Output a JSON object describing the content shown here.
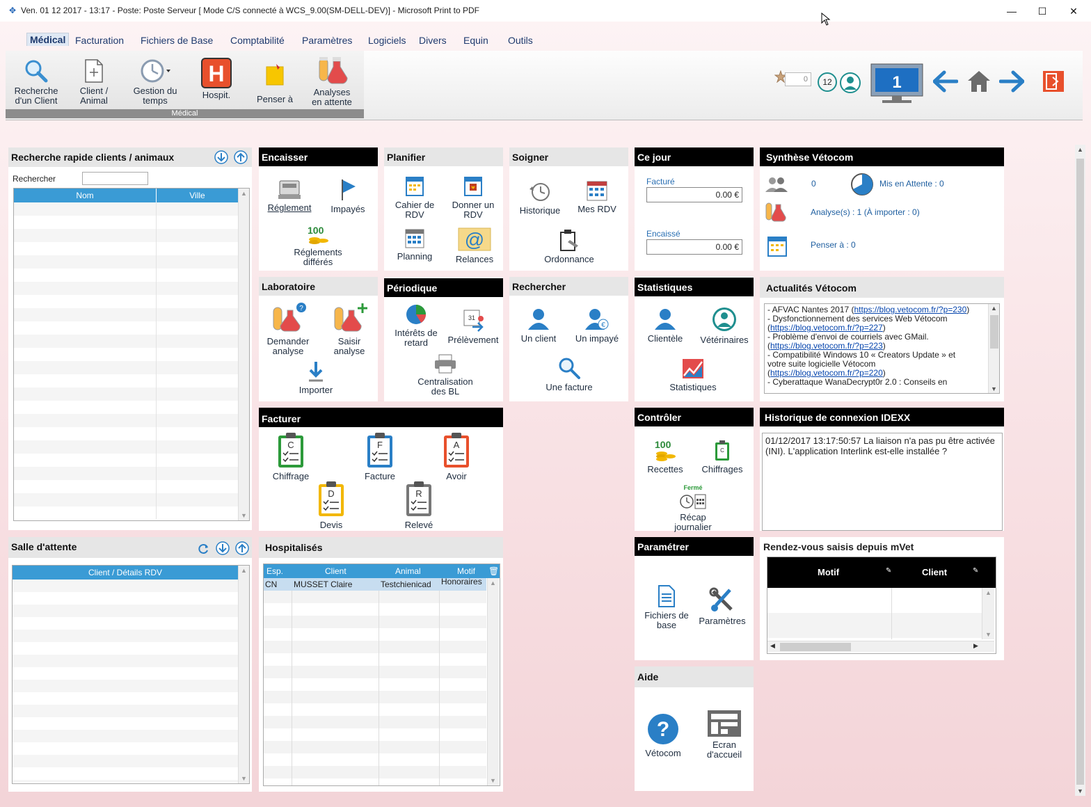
{
  "window": {
    "title": "Ven. 01 12 2017 - 13:17 - Poste: Poste Serveur  [ Mode C/S connecté à WCS_9.00(SM-DELL-DEV)] - Microsoft Print to PDF",
    "minimize": "—",
    "maximize": "☐",
    "close": "✕"
  },
  "menu": [
    "Médical",
    "Facturation",
    "Fichiers de Base",
    "Comptabilité",
    "Paramètres",
    "Logiciels",
    "Divers",
    "Equin",
    "Outils"
  ],
  "ribbon": {
    "group_label": "Médical",
    "buttons": [
      {
        "l1": "Recherche",
        "l2": "d'un Client"
      },
      {
        "l1": "Client /",
        "l2": "Animal"
      },
      {
        "l1": "Gestion du",
        "l2": "temps"
      },
      {
        "l1": "",
        "l2": "Hospit."
      },
      {
        "l1": "",
        "l2": "Penser à"
      },
      {
        "l1": "Analyses",
        "l2": "en attente"
      }
    ],
    "hospit_letter": "H",
    "star_value": "0",
    "badge_count": "12",
    "monitor_number": "1"
  },
  "quick_search": {
    "title": "Recherche rapide clients / animaux",
    "search_label": "Rechercher",
    "search_value": "",
    "col_nom": "Nom",
    "col_ville": "Ville"
  },
  "waiting_room": {
    "title": "Salle d'attente",
    "col": "Client / Détails RDV"
  },
  "encaisser": {
    "title": "Encaisser",
    "reglement": "Réglement",
    "impayes": "Impayés",
    "reglements_differes_1": "Réglements",
    "reglements_differes_2": "différés"
  },
  "planifier": {
    "title": "Planifier",
    "cahier_1": "Cahier de",
    "cahier_2": "RDV",
    "donner_1": "Donner un",
    "donner_2": "RDV",
    "planning": "Planning",
    "relances": "Relances"
  },
  "soigner": {
    "title": "Soigner",
    "historique": "Historique",
    "mes_rdv": "Mes RDV",
    "ordonnance": "Ordonnance"
  },
  "ce_jour": {
    "title": "Ce jour",
    "facture_label": "Facturé",
    "facture_value": "0.00 €",
    "encaisse_label": "Encaissé",
    "encaisse_value": "0.00 €"
  },
  "synthese": {
    "title": "Synthèse Vétocom",
    "clients_count": "0",
    "mis_en_attente": "Mis en Attente : 0",
    "analyses": "Analyse(s) : 1  (À importer : 0)",
    "penser": "Penser à : 0"
  },
  "laboratoire": {
    "title": "Laboratoire",
    "demander_1": "Demander",
    "demander_2": "analyse",
    "saisir_1": "Saisir",
    "saisir_2": "analyse",
    "importer": "Importer"
  },
  "periodique": {
    "title": "Périodique",
    "interets_1": "Intérêts de",
    "interets_2": "retard",
    "prelevement": "Prélèvement",
    "centralisation_1": "Centralisation",
    "centralisation_2": "des BL"
  },
  "rechercher": {
    "title": "Rechercher",
    "un_client": "Un client",
    "un_impaye": "Un impayé",
    "une_facture": "Une facture"
  },
  "statistiques": {
    "title": "Statistiques",
    "clientele": "Clientèle",
    "veterinaires": "Vétérinaires",
    "statistiques": "Statistiques"
  },
  "actualites": {
    "title": "Actualités Vétocom",
    "lines": [
      {
        "text": "- AFVAC Nantes 2017 (",
        "link": "https://blog.vetocom.fr/?p=230",
        "after": ")"
      },
      {
        "text": "- Dysfonctionnement des services Web Vétocom",
        "link": "",
        "after": ""
      },
      {
        "text": "(",
        "link": "https://blog.vetocom.fr/?p=227",
        "after": ")"
      },
      {
        "text": "- Problème d'envoi de courriels avec GMail.",
        "link": "",
        "after": ""
      },
      {
        "text": "(",
        "link": "https://blog.vetocom.fr/?p=223",
        "after": ")"
      },
      {
        "text": "- Compatibilité Windows 10 « Creators Update » et",
        "link": "",
        "after": ""
      },
      {
        "text": "votre suite logicielle Vétocom",
        "link": "",
        "after": ""
      },
      {
        "text": "(",
        "link": "https://blog.vetocom.fr/?p=220",
        "after": ")"
      },
      {
        "text": "- Cyberattaque WanaDecrypt0r 2.0 : Conseils en",
        "link": "",
        "after": ""
      }
    ]
  },
  "facturer": {
    "title": "Facturer",
    "chiffrage": "Chiffrage",
    "chiffrage_letter": "C",
    "facture": "Facture",
    "facture_letter": "F",
    "avoir": "Avoir",
    "avoir_letter": "A",
    "devis": "Devis",
    "devis_letter": "D",
    "releve": "Relevé",
    "releve_letter": "R"
  },
  "controler": {
    "title": "Contrôler",
    "recettes": "Recettes",
    "chiffrages": "Chiffrages",
    "ferme": "Fermé",
    "recap_1": "Récap",
    "recap_2": "journalier"
  },
  "idexx": {
    "title": "Historique de connexion IDEXX",
    "message": "01/12/2017 13:17:50:57 La liaison n'a pas pu être activée (INI). L'application Interlink est-elle installée ?"
  },
  "hospitalises": {
    "title": "Hospitalisés",
    "cols": [
      "Esp.",
      "Client",
      "Animal",
      "Motif"
    ],
    "rows": [
      {
        "esp": "CN",
        "client": "MUSSET Claire",
        "animal": "Testchienicad",
        "motif": "Honoraires"
      }
    ]
  },
  "parametrer": {
    "title": "Paramétrer",
    "fichiers_1": "Fichiers de",
    "fichiers_2": "base",
    "parametres": "Paramètres"
  },
  "mvet": {
    "title": "Rendez-vous saisis depuis mVet",
    "col_motif": "Motif",
    "col_client": "Client"
  },
  "aide": {
    "title": "Aide",
    "vetocom": "Vétocom",
    "ecran_1": "Ecran",
    "ecran_2": "d'accueil"
  },
  "colors": {
    "accent_blue": "#3a9bd5",
    "header_black": "#000000",
    "hospit_red": "#e8502c"
  }
}
